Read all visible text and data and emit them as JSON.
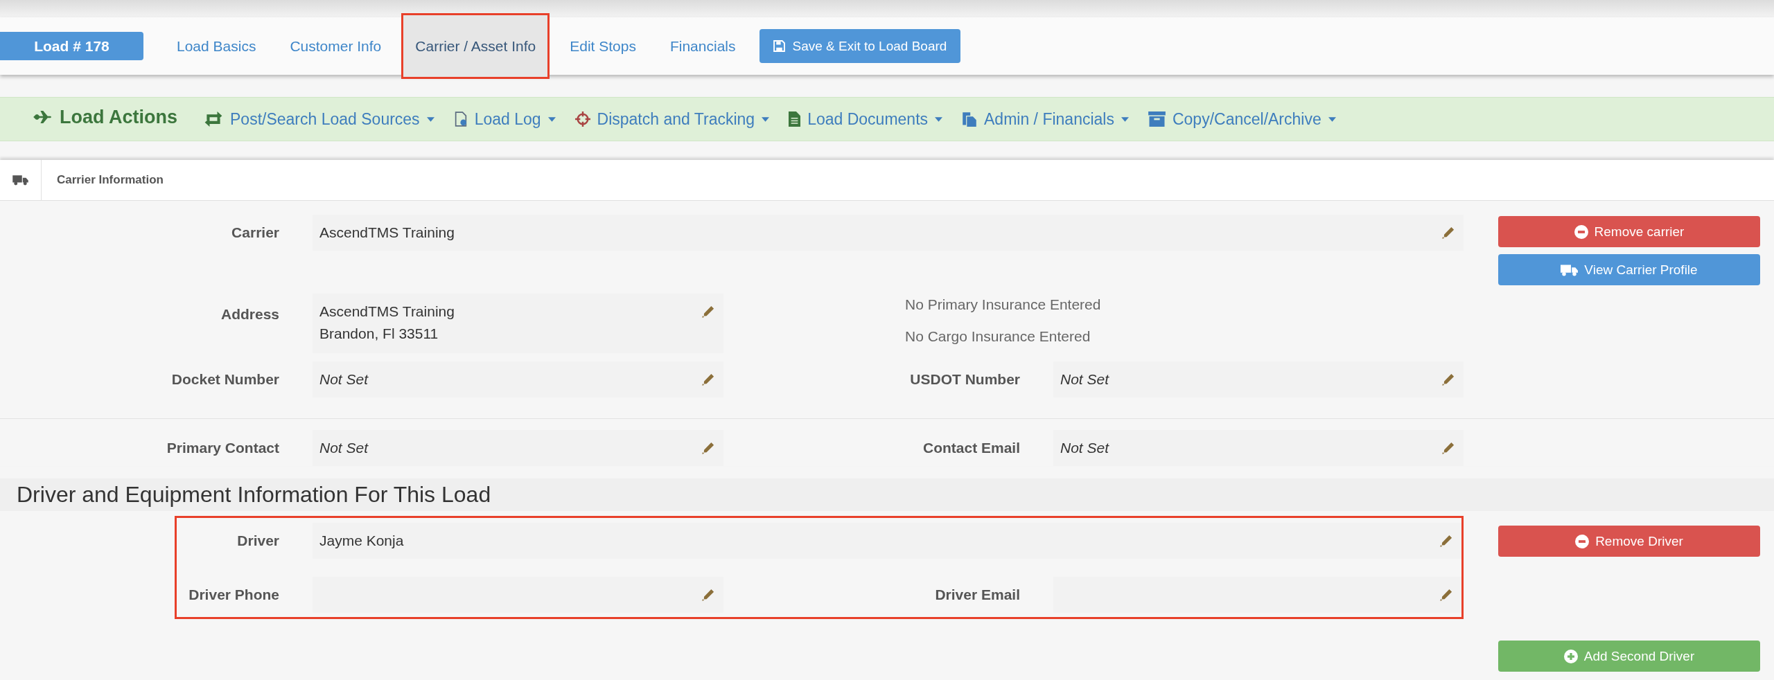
{
  "nav": {
    "load_badge": "Load # 178",
    "tabs": [
      {
        "label": "Load Basics",
        "selected": false,
        "highlighted": false
      },
      {
        "label": "Customer Info",
        "selected": false,
        "highlighted": false
      },
      {
        "label": "Carrier / Asset Info",
        "selected": true,
        "highlighted": true
      },
      {
        "label": "Edit Stops",
        "selected": false,
        "highlighted": false
      },
      {
        "label": "Financials",
        "selected": false,
        "highlighted": false
      }
    ],
    "save_button": "Save & Exit to Load Board"
  },
  "actions": {
    "title": "Load Actions",
    "menus": [
      {
        "label": "Post/Search Load Sources"
      },
      {
        "label": "Load Log"
      },
      {
        "label": "Dispatch and Tracking"
      },
      {
        "label": "Load Documents"
      },
      {
        "label": "Admin / Financials"
      },
      {
        "label": "Copy/Cancel/Archive"
      }
    ]
  },
  "carrier_panel": {
    "title": "Carrier Information",
    "rows": [
      {
        "kind": "wide",
        "label": "Carrier",
        "value": "AscendTMS Training",
        "set": true,
        "buttons": [
          {
            "label": "Remove carrier",
            "kind": "remove"
          },
          {
            "label": "View Carrier Profile",
            "kind": "profile"
          }
        ]
      },
      {
        "kind": "address",
        "label": "Address",
        "lines": [
          "AscendTMS Training",
          "Brandon, Fl 33511"
        ],
        "notes": [
          "No Primary Insurance Entered",
          "No Cargo Insurance Entered"
        ]
      },
      {
        "kind": "pair",
        "fields": [
          {
            "label": "Docket Number",
            "value": "Not Set",
            "set": false
          },
          {
            "label": "USDOT Number",
            "value": "Not Set",
            "set": false
          }
        ]
      },
      {
        "kind": "pair",
        "divider_before": true,
        "fields": [
          {
            "label": "Primary Contact",
            "value": "Not Set",
            "set": false
          },
          {
            "label": "Contact Email",
            "value": "Not Set",
            "set": false
          }
        ]
      }
    ]
  },
  "driver_section": {
    "title": "Driver and Equipment Information For This Load",
    "highlighted": true,
    "rows": [
      {
        "kind": "wide",
        "label": "Driver",
        "value": "Jayme Konja",
        "set": true,
        "buttons": [
          {
            "label": "Remove Driver",
            "kind": "remove"
          }
        ]
      },
      {
        "kind": "pair",
        "fields": [
          {
            "label": "Driver Phone"
          },
          {
            "label": "Driver Email"
          }
        ]
      }
    ],
    "add_button": {
      "label": "Add Second Driver",
      "kind": "add"
    }
  }
}
